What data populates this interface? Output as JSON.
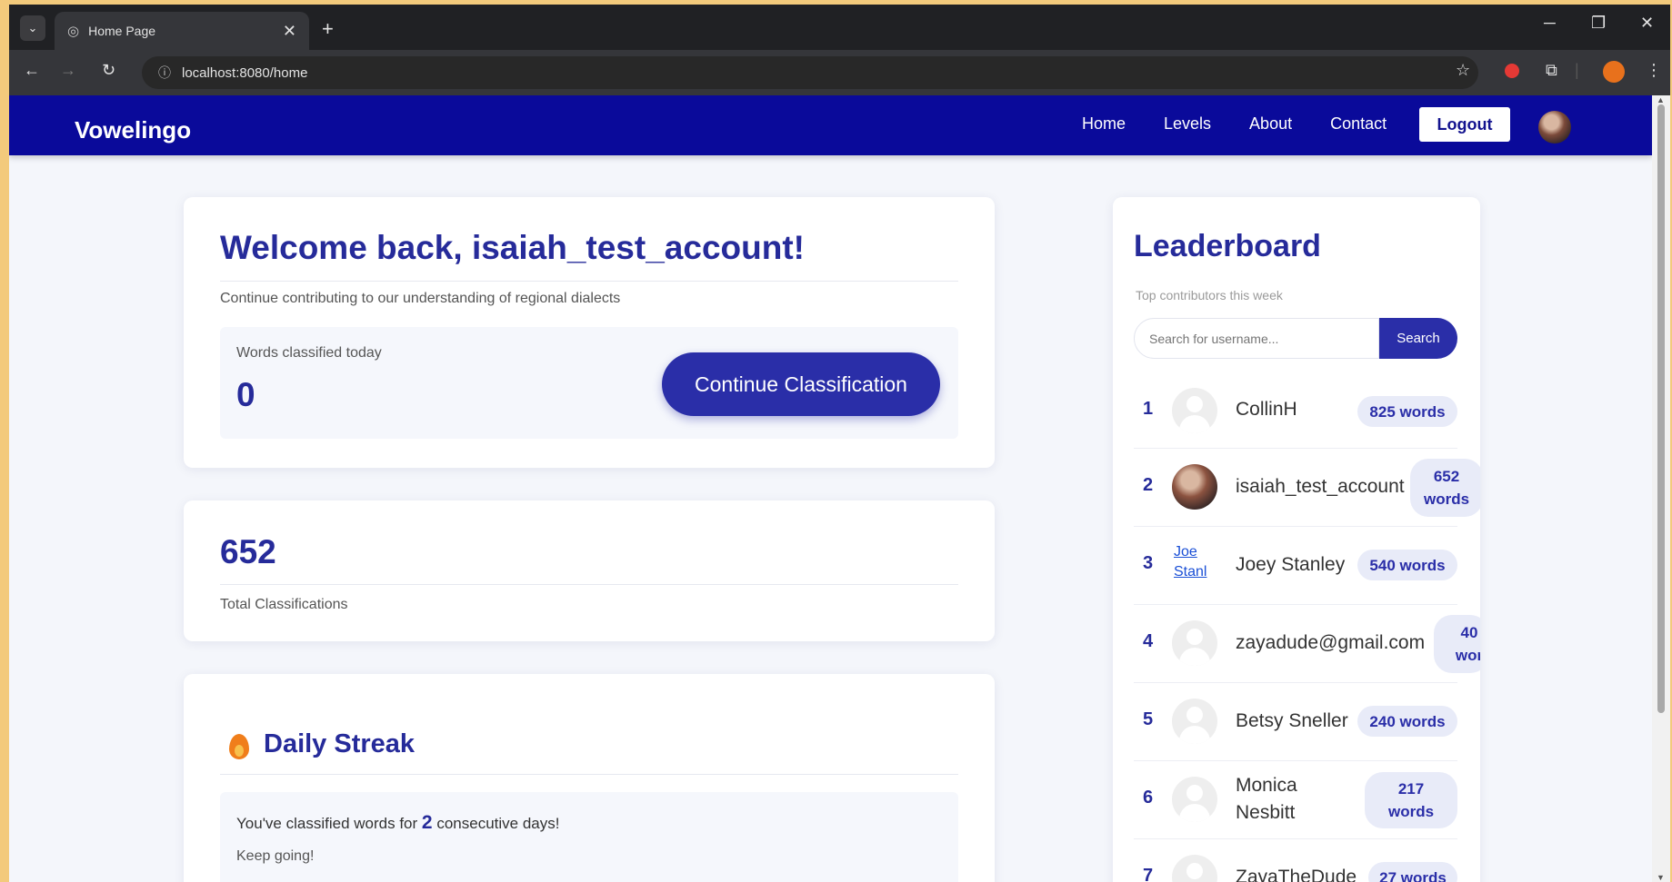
{
  "browser": {
    "tab_title": "Home Page",
    "url": "localhost:8080/home"
  },
  "navbar": {
    "brand": "Vowelingo",
    "links": [
      "Home",
      "Levels",
      "About",
      "Contact"
    ],
    "logout_label": "Logout"
  },
  "welcome": {
    "title": "Welcome back, isaiah_test_account!",
    "subtitle": "Continue contributing to our understanding of regional dialects",
    "today_label": "Words classified today",
    "today_value": "0",
    "continue_label": "Continue Classification"
  },
  "totals": {
    "value": "652",
    "label": "Total Classifications"
  },
  "streak": {
    "title": "Daily Streak",
    "text_before": "You've classified words for",
    "days": "2",
    "text_after": "consecutive days!",
    "encouragement": "Keep going!"
  },
  "leaderboard": {
    "title": "Leaderboard",
    "subtitle": "Top contributors this week",
    "search_placeholder": "Search for username...",
    "search_label": "Search",
    "entries": [
      {
        "rank": "1",
        "name": "CollinH",
        "words": "825 words"
      },
      {
        "rank": "2",
        "name": "isaiah_test_account",
        "words": "652 words"
      },
      {
        "rank": "3",
        "name": "Joey Stanley",
        "words": "540 words",
        "alt": "Joe Stanl"
      },
      {
        "rank": "4",
        "name": "zayadude@gmail.com",
        "words": "40 wor"
      },
      {
        "rank": "5",
        "name": "Betsy Sneller",
        "words": "240 words"
      },
      {
        "rank": "6",
        "name": "Monica Nesbitt",
        "words": "217 words"
      },
      {
        "rank": "7",
        "name": "ZayaTheDude",
        "words": "27 words"
      }
    ]
  },
  "colors": {
    "brand_navy": "#0a0a9a",
    "accent": "#2a2ea8",
    "heading": "#262b9a",
    "streak_flame": "#f07e1b"
  }
}
